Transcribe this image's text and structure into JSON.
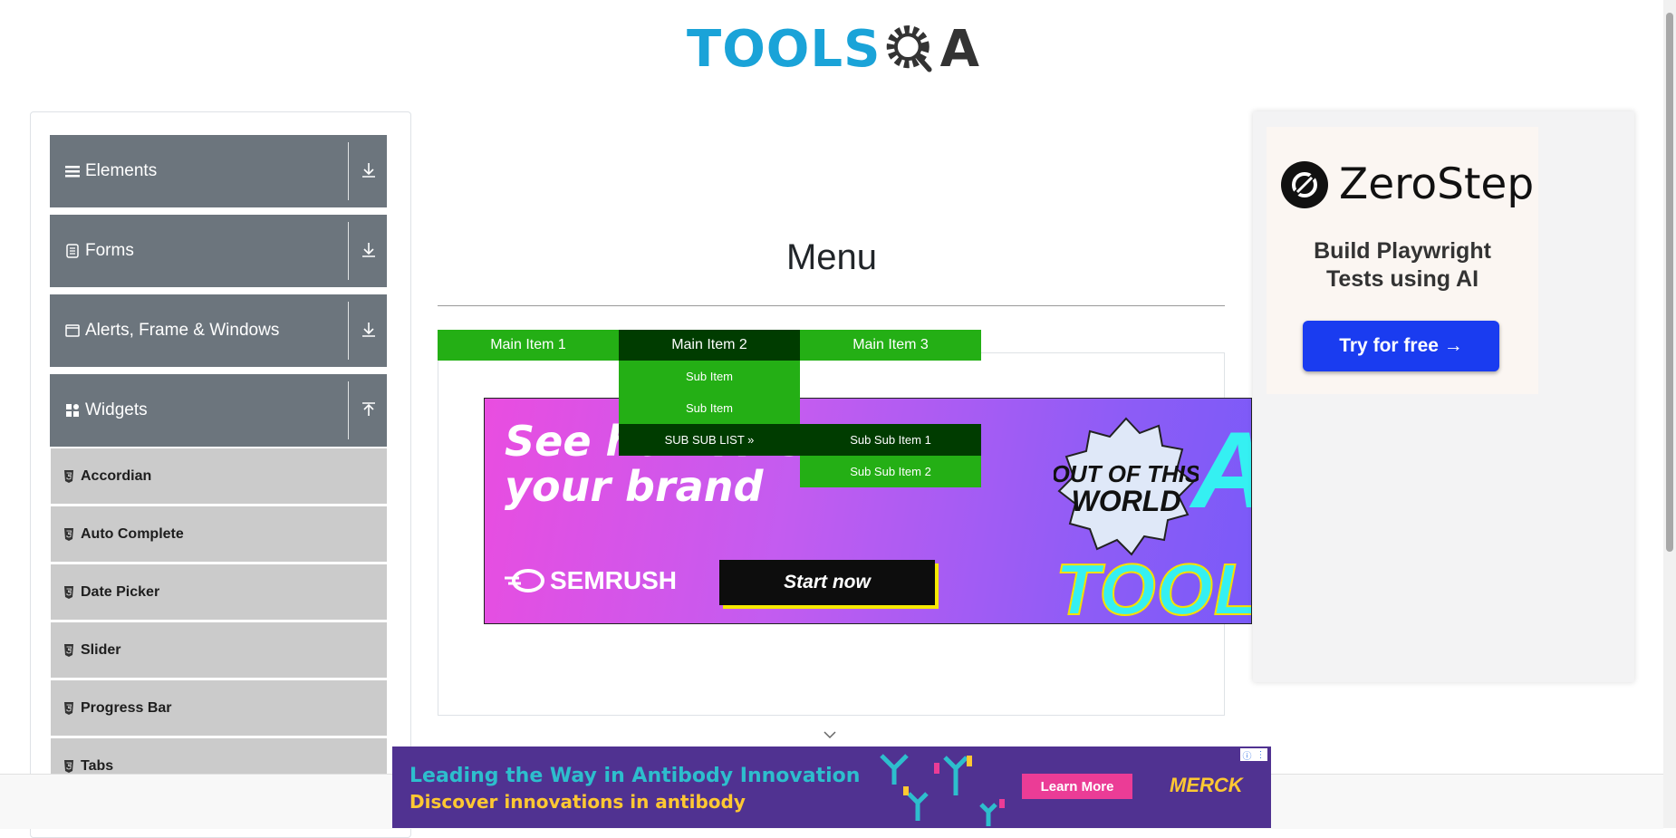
{
  "logo": {
    "left": "TOOLS",
    "right": "A"
  },
  "sidebar": {
    "groups": [
      {
        "label": "Elements",
        "icon": "hamburger-icon",
        "arrow": "download-arrow-icon"
      },
      {
        "label": "Forms",
        "icon": "document-icon",
        "arrow": "download-arrow-icon"
      },
      {
        "label": "Alerts, Frame & Windows",
        "icon": "window-icon",
        "arrow": "download-arrow-icon"
      },
      {
        "label": "Widgets",
        "icon": "grid-icon",
        "arrow": "upload-arrow-icon"
      }
    ],
    "items": [
      "Accordian",
      "Auto Complete",
      "Date Picker",
      "Slider",
      "Progress Bar",
      "Tabs"
    ]
  },
  "main": {
    "title": "Menu"
  },
  "menu": {
    "main_items": [
      "Main Item 1",
      "Main Item 2",
      "Main Item 3"
    ],
    "sub_items": [
      "Sub Item",
      "Sub Item",
      "SUB SUB LIST »"
    ],
    "sub_sub_items": [
      "Sub Sub Item 1",
      "Sub Sub Item 2"
    ],
    "colors": {
      "item": "#24af15",
      "hover": "#003c00"
    }
  },
  "ads": {
    "semrush": {
      "headline_1": "See how AI sees",
      "headline_2": "your brand",
      "brand": "SEMRUSH",
      "cta": "Start now",
      "badge": "OUT OF THIS WORLD",
      "big_letter": "A",
      "bottom_word": "TOOLK"
    },
    "zerostep": {
      "brand": "ZeroStep",
      "tagline_1": "Build Playwright",
      "tagline_2": "Tests using AI",
      "cta": "Try for free →"
    },
    "merck": {
      "line1": "Leading the Way in Antibody Innovation",
      "line2": "Discover innovations in antibody",
      "cta": "Learn More",
      "brand": "MERCK"
    }
  }
}
